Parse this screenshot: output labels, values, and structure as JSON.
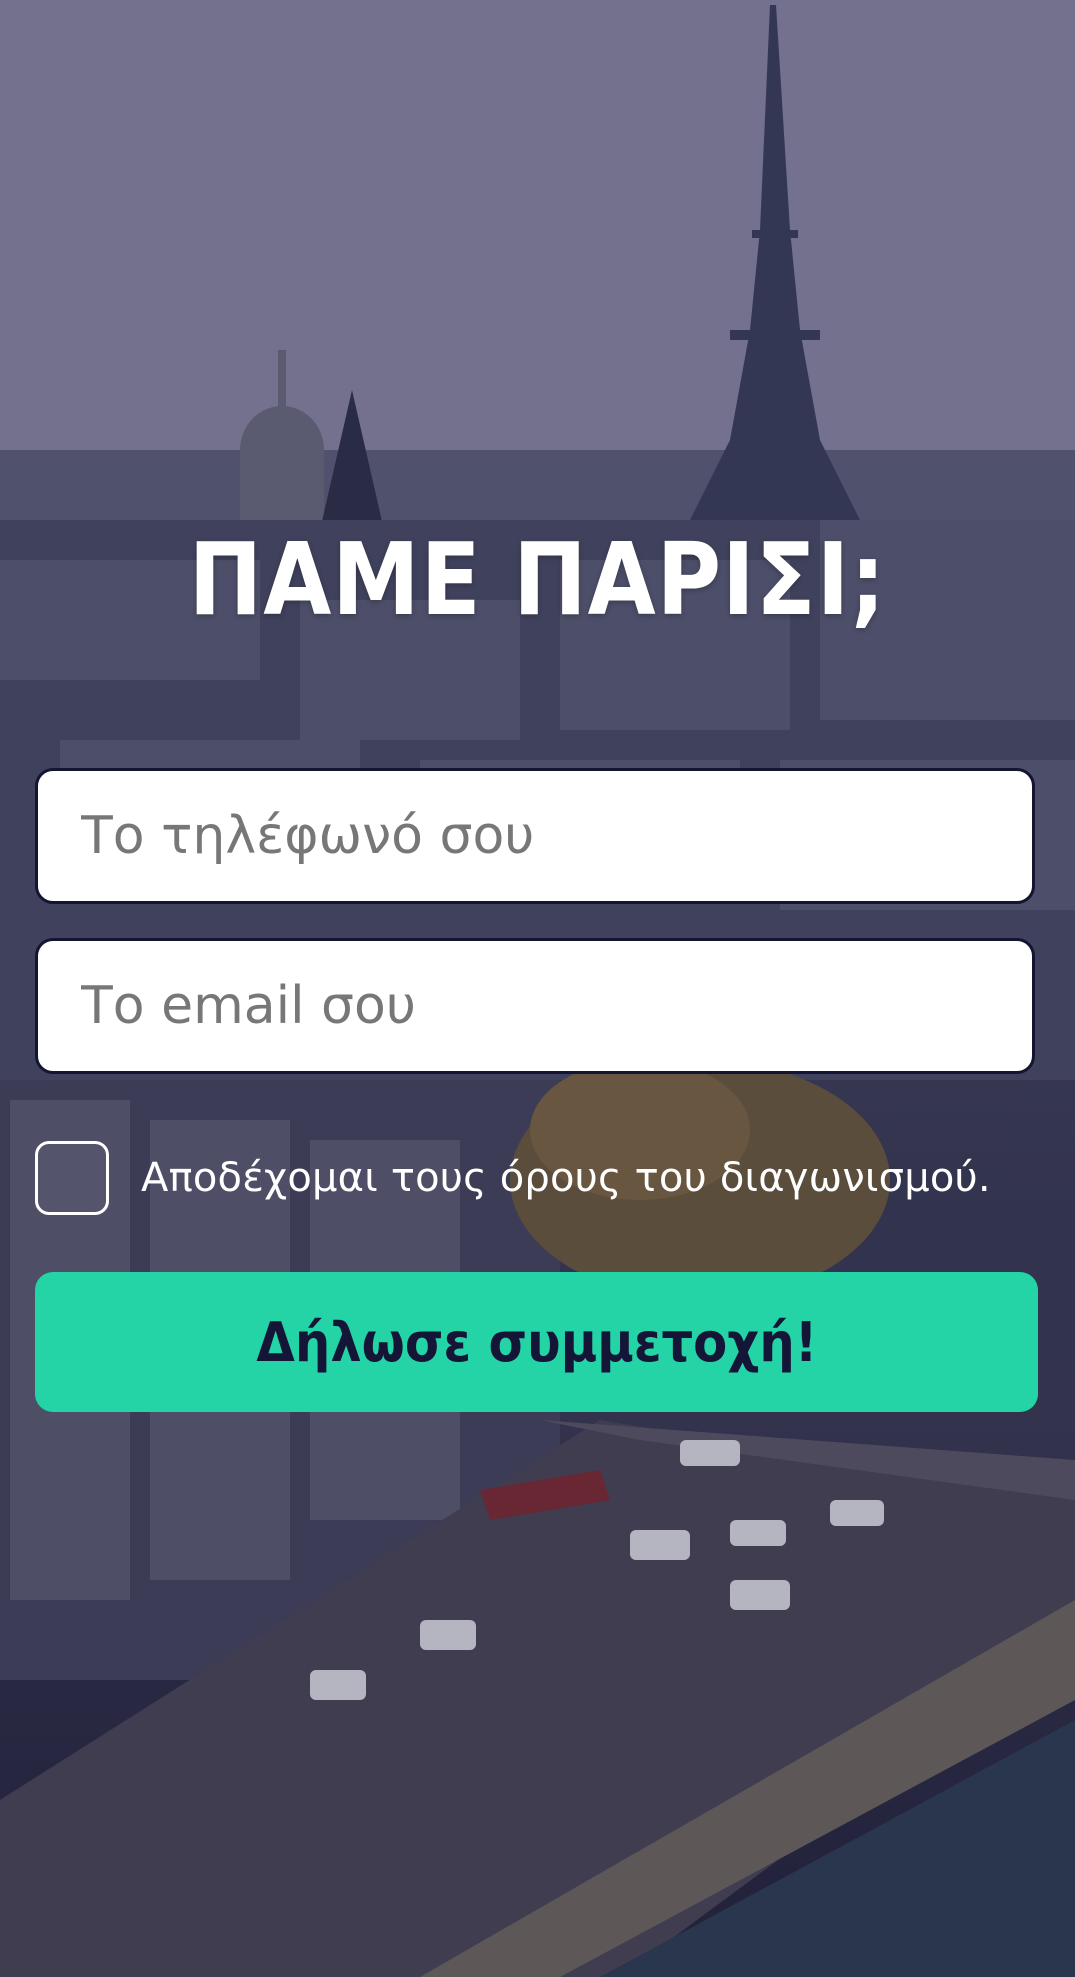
{
  "hero": {
    "title": "ΠΑΜΕ ΠΑΡΙΣΙ;"
  },
  "form": {
    "phone_placeholder": "Το τηλέφωνό σου",
    "phone_value": "",
    "email_placeholder": "Το email σου",
    "email_value": "",
    "terms_label": "Αποδέχομαι τους όρους του διαγωνισμού.",
    "terms_checked": false,
    "submit_label": "Δήλωσε συμμετοχή!"
  },
  "colors": {
    "accent": "#24d3a6",
    "text_dark": "#151538",
    "border": "#141433",
    "placeholder": "#777777"
  },
  "background": {
    "icon": "paris-skyline-photo"
  }
}
